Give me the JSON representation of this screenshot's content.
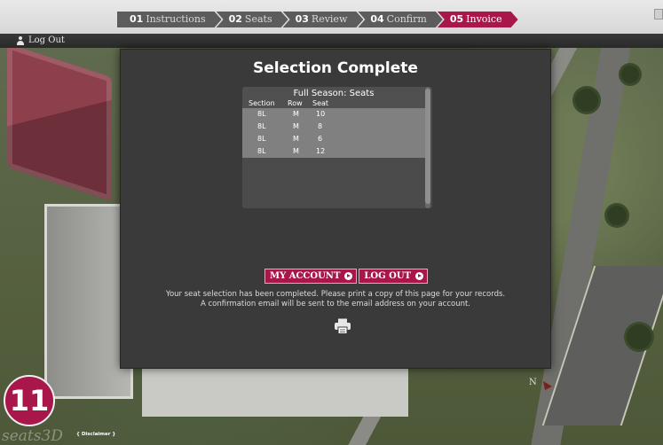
{
  "steps": [
    {
      "num": "01",
      "label": "Instructions",
      "active": false
    },
    {
      "num": "02",
      "label": "Seats",
      "active": false
    },
    {
      "num": "03",
      "label": "Review",
      "active": false
    },
    {
      "num": "04",
      "label": "Confirm",
      "active": false
    },
    {
      "num": "05",
      "label": "Invoice",
      "active": true
    }
  ],
  "header": {
    "logout_label": "Log Out",
    "user_icon": "user-icon"
  },
  "modal": {
    "title": "Selection Complete",
    "panel_title": "Full Season: Seats",
    "columns": [
      "Section",
      "Row",
      "Seat"
    ],
    "seats": [
      {
        "section": "8L",
        "row": "M",
        "seat": "10"
      },
      {
        "section": "8L",
        "row": "M",
        "seat": "8"
      },
      {
        "section": "8L",
        "row": "M",
        "seat": "6"
      },
      {
        "section": "8L",
        "row": "M",
        "seat": "12"
      }
    ],
    "buttons": {
      "my_account": "MY ACCOUNT",
      "log_out": "LOG OUT"
    },
    "message_line1": "Your seat selection has been completed. Please print a copy of this page for your records.",
    "message_line2": "A confirmation email will be sent to the email address on your account.",
    "print_icon": "printer-icon"
  },
  "footer": {
    "badge": "11",
    "brand": "seats3D",
    "disclaimer": "{ Disclaimer }",
    "compass_label": "N"
  },
  "colors": {
    "accent": "#a8164a",
    "modal_bg": "#3a3a3a",
    "step_bg": "#5c5c5c"
  }
}
